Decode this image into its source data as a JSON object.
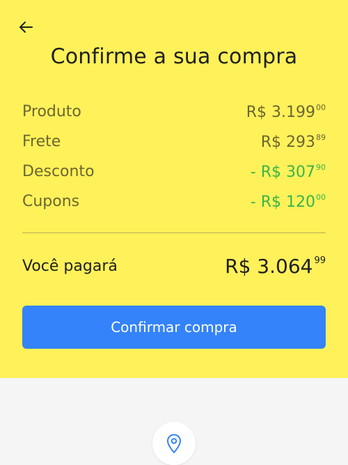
{
  "header": {
    "back_icon": "arrow-left-icon",
    "title": "Confirme a sua compra"
  },
  "summary": {
    "rows": [
      {
        "label": "Produto",
        "amount_main": "R$ 3.199",
        "amount_cents": "00",
        "color": "#6b6630"
      },
      {
        "label": "Frete",
        "amount_main": "R$ 293",
        "amount_cents": "89",
        "color": "#6b6630"
      },
      {
        "label": "Desconto",
        "amount_main": "- R$ 307",
        "amount_cents": "90",
        "color": "#39b54a"
      },
      {
        "label": "Cupons",
        "amount_main": "- R$ 120",
        "amount_cents": "00",
        "color": "#39b54a"
      }
    ]
  },
  "total": {
    "label": "Você pagará",
    "amount_main": "R$ 3.064",
    "amount_cents": "99"
  },
  "confirm_button": {
    "label": "Confirmar compra"
  },
  "location": {
    "icon": "map-pin-icon"
  },
  "colors": {
    "panel_background": "#fff159",
    "page_background": "#f5f5f5",
    "button_background": "#3483fa",
    "discount_green": "#39b54a"
  }
}
